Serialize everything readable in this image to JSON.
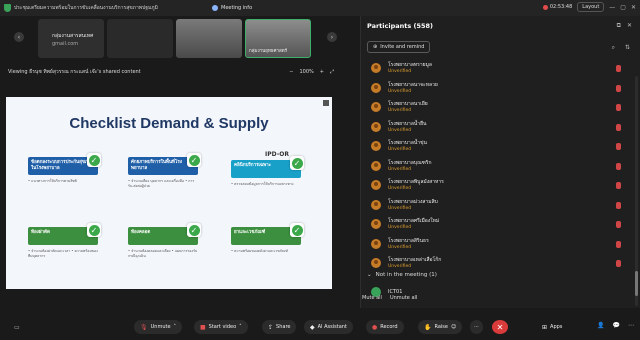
{
  "topbar": {
    "title": "ประชุมเตรียมความพร้อมในการขับเคลื่อนงานบริการสุขภาพปฐมภูมิ",
    "meeting_info": "Meeting info",
    "timer": "02:53:48",
    "layout": "Layout"
  },
  "thumbnails": [
    {
      "label": "กลุ่มงานสารสนเทศ",
      "sub": "gmail.com"
    },
    {
      "label": ""
    },
    {
      "label": ""
    },
    {
      "label": "กลุ่มงานยุทธศาสตร์"
    }
  ],
  "viewbar": {
    "text": "Viewing ธีรนุช ทิพย์สุวรรณ กระแสน์ เจ๊ะ's shared content",
    "zoom": "100%"
  },
  "slide": {
    "title": "Checklist Demand & Supply",
    "ipd": "IPD-OR",
    "cards": [
      {
        "head": "ข้อตกลงระบบการประกันสุขภาพในโรงพยาบาล",
        "body": "• แนวทางการให้บริการตามสิทธิ"
      },
      {
        "head": "ศักยภาพบริการในพื้นที่โรงพยาบาล",
        "body": "• จำนวนเตียง บุคลากร และเครื่องมือ • การรับ-ส่งต่อผู้ป่วย"
      },
      {
        "head": "คลินิกบริการเฉพาะ",
        "body": "• ตรวจสอบข้อมูลการให้บริการเฉพาะทาง"
      },
      {
        "head": "ห้องผ่าตัด",
        "body": "• จำนวนห้องผ่าตัดและเวลา • ความพร้อมของทีมบุคลากร"
      },
      {
        "head": "ห้องคลอด",
        "body": "• จำนวนห้องคลอดและเตียง • แผนการรองรับกรณีฉุกเฉิน"
      },
      {
        "head": "ยาและเวชภัณฑ์",
        "body": "• ความพร้อมของคลังยาและเวชภัณฑ์"
      }
    ]
  },
  "panel": {
    "title": "Participants (558)",
    "invite": "Invite and remind",
    "participants": [
      {
        "name": "โรงพยาบาลทรายมูล",
        "status": "Unverified"
      },
      {
        "name": "โรงพยาบาลนาจะหลวย",
        "status": "Unverified"
      },
      {
        "name": "โรงพยาบาลนาเยีย",
        "status": "Unverified"
      },
      {
        "name": "โรงพยาบาลน้ำยืน",
        "status": "Unverified"
      },
      {
        "name": "โรงพยาบาลน้ำขุ่น",
        "status": "Unverified"
      },
      {
        "name": "โรงพยาบาลบุณฑริก",
        "status": "Unverified"
      },
      {
        "name": "โรงพยาบาลพิบูลมังสาหาร",
        "status": "Unverified"
      },
      {
        "name": "โรงพยาบาลม่วงสามสิบ",
        "status": "Unverified"
      },
      {
        "name": "โรงพยาบาลศรีเมืองใหม่",
        "status": "Unverified"
      },
      {
        "name": "โรงพยาบาลสิรินธร",
        "status": "Unverified"
      },
      {
        "name": "โรงพยาบาลเหล่าเสือโก้ก",
        "status": "Unverified"
      }
    ],
    "not_in_meeting": "Not in the meeting (1)",
    "ict": "ICT01",
    "mute_all": "Mute all",
    "unmute_all": "Unmute all"
  },
  "toolbar": {
    "unmute": "Unmute",
    "start_video": "Start video",
    "share": "Share",
    "ai": "AI Assistant",
    "record": "Record",
    "raise": "Raise",
    "apps": "Apps"
  }
}
